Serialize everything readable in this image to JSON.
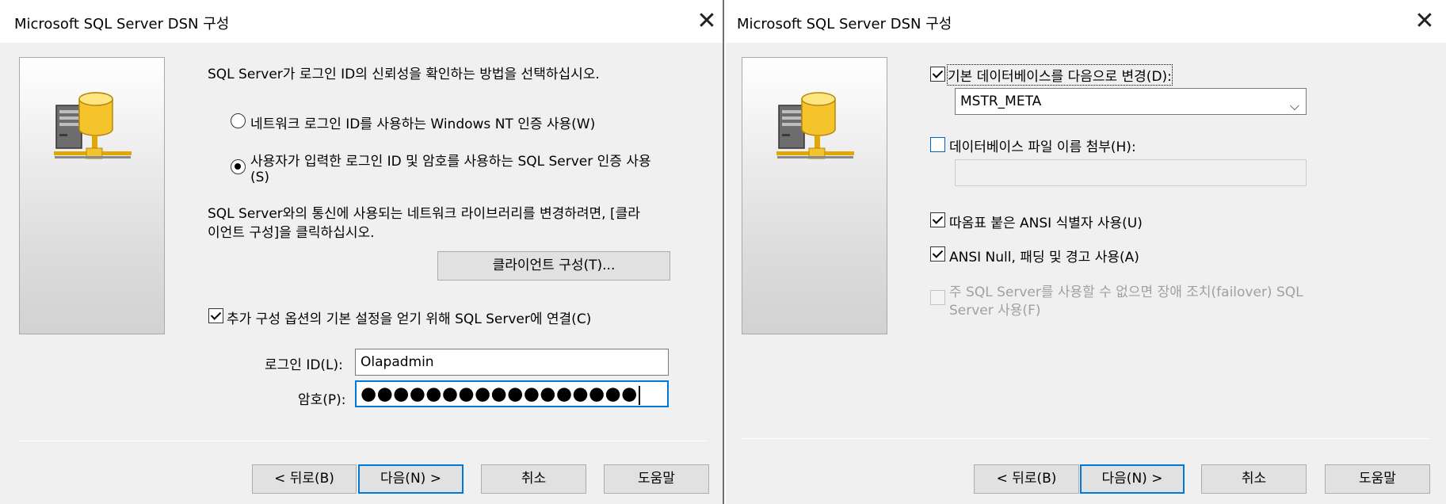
{
  "dialog1": {
    "title": "Microsoft SQL Server DSN 구성",
    "prompt": "SQL Server가 로그인 ID의 신뢰성을 확인하는 방법을 선택하십시오.",
    "radio_windows_auth": "네트워크 로그인 ID를 사용하는 Windows NT 인증 사용(W)",
    "radio_sql_auth_line1": "사용자가 입력한 로그인 ID 및 암호를 사용하는 SQL Server 인증 사용",
    "radio_sql_auth_line2": "(S)",
    "selected_auth": "sql",
    "network_text_line1": "SQL Server와의 통신에 사용되는 네트워크 라이브러리를 변경하려면, [클라",
    "network_text_line2": "이언트 구성]을 클릭하십시오.",
    "client_config_button": "클라이언트 구성(T)...",
    "connect_checkbox_label": "추가 구성 옵션의 기본 설정을 얻기 위해 SQL Server에 연결(C)",
    "connect_checked": true,
    "login_id_label": "로그인 ID(L):",
    "login_id_value": "Olapadmin",
    "password_label": "암호(P):",
    "password_value": "●●●●●●●●●●●●●●●●●",
    "buttons": {
      "back": "< 뒤로(B)",
      "next": "다음(N) >",
      "cancel": "취소",
      "help": "도움말"
    }
  },
  "dialog2": {
    "title": "Microsoft SQL Server DSN 구성",
    "change_db_label": "기본 데이터베이스를 다음으로 변경(D):",
    "change_db_checked": true,
    "database_value": "MSTR_META",
    "attach_db_label": "데이터베이스 파일 이름 첨부(H):",
    "attach_db_checked": false,
    "attach_db_path": "",
    "quoted_identifiers_label": "따옴표 붙은 ANSI 식별자 사용(U)",
    "quoted_identifiers_checked": true,
    "ansi_nulls_label": "ANSI Null, 패딩 및 경고 사용(A)",
    "ansi_nulls_checked": true,
    "failover_label_line1": "주 SQL Server를 사용할 수 없으면 장애 조치(failover) SQL",
    "failover_label_line2": "Server 사용(F)",
    "failover_checked": false,
    "buttons": {
      "back": "< 뒤로(B)",
      "next": "다음(N) >",
      "cancel": "취소",
      "help": "도움말"
    }
  },
  "icons": {
    "close": "✕",
    "dropdown": "⌵"
  },
  "colors": {
    "accent": "#0078d7",
    "dialog_bg": "#f0f0f0",
    "disabled_text": "#a0a0a0"
  }
}
